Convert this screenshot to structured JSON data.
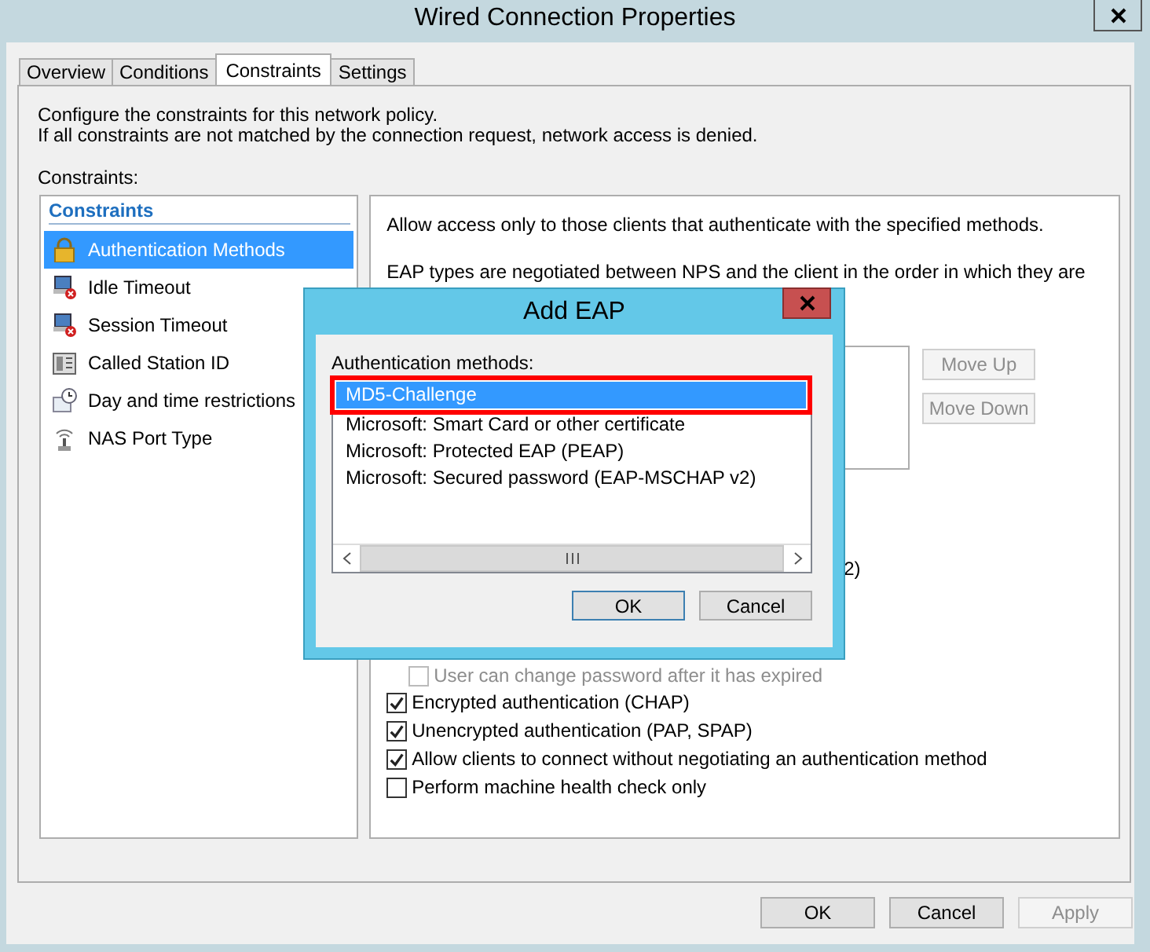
{
  "window": {
    "title": "Wired Connection Properties"
  },
  "tabs": [
    {
      "label": "Overview",
      "selected": false
    },
    {
      "label": "Conditions",
      "selected": false
    },
    {
      "label": "Constraints",
      "selected": true
    },
    {
      "label": "Settings",
      "selected": false
    }
  ],
  "description": [
    "Configure the constraints for this network policy.",
    "If all constraints are not matched by the connection request, network access is denied."
  ],
  "constraints_label": "Constraints:",
  "constraints_list": {
    "heading": "Constraints",
    "items": [
      {
        "label": "Authentication Methods",
        "selected": true
      },
      {
        "label": "Idle Timeout",
        "selected": false
      },
      {
        "label": "Session Timeout",
        "selected": false
      },
      {
        "label": "Called Station ID",
        "selected": false
      },
      {
        "label": "Day and time restrictions",
        "selected": false
      },
      {
        "label": "NAS Port Type",
        "selected": false
      }
    ]
  },
  "detail": {
    "intro": "Allow access only to those clients that authenticate with the specified methods.",
    "eap_note": "EAP types are negotiated between NPS and the client in the order in which they are",
    "order_buttons": [
      {
        "label": "Move Up",
        "disabled": true
      },
      {
        "label": "Move Down",
        "disabled": true
      }
    ],
    "fragment": "2)",
    "options": [
      {
        "label": "User can change password after it has expired",
        "kind": "sub",
        "checked": false,
        "disabled": true
      },
      {
        "label": "Encrypted authentication (CHAP)",
        "kind": "main",
        "checked": true,
        "disabled": false
      },
      {
        "label": "Unencrypted authentication (PAP, SPAP)",
        "kind": "main",
        "checked": true,
        "disabled": false
      },
      {
        "label": "Allow clients to connect without negotiating an authentication method",
        "kind": "main",
        "checked": true,
        "disabled": false
      },
      {
        "label": "Perform machine health check only",
        "kind": "main",
        "checked": false,
        "disabled": false
      }
    ]
  },
  "buttons": [
    {
      "label": "OK",
      "disabled": false
    },
    {
      "label": "Cancel",
      "disabled": false
    },
    {
      "label": "Apply",
      "disabled": true
    }
  ],
  "dialog": {
    "title": "Add EAP",
    "label": "Authentication methods:",
    "methods": [
      {
        "label": "MD5-Challenge",
        "selected": true
      },
      {
        "label": "Microsoft: Smart Card or other certificate",
        "selected": false
      },
      {
        "label": "Microsoft: Protected EAP (PEAP)",
        "selected": false
      },
      {
        "label": "Microsoft: Secured password (EAP-MSCHAP v2)",
        "selected": false
      }
    ],
    "buttons": [
      {
        "label": "OK",
        "default": true
      },
      {
        "label": "Cancel",
        "default": false
      }
    ]
  }
}
